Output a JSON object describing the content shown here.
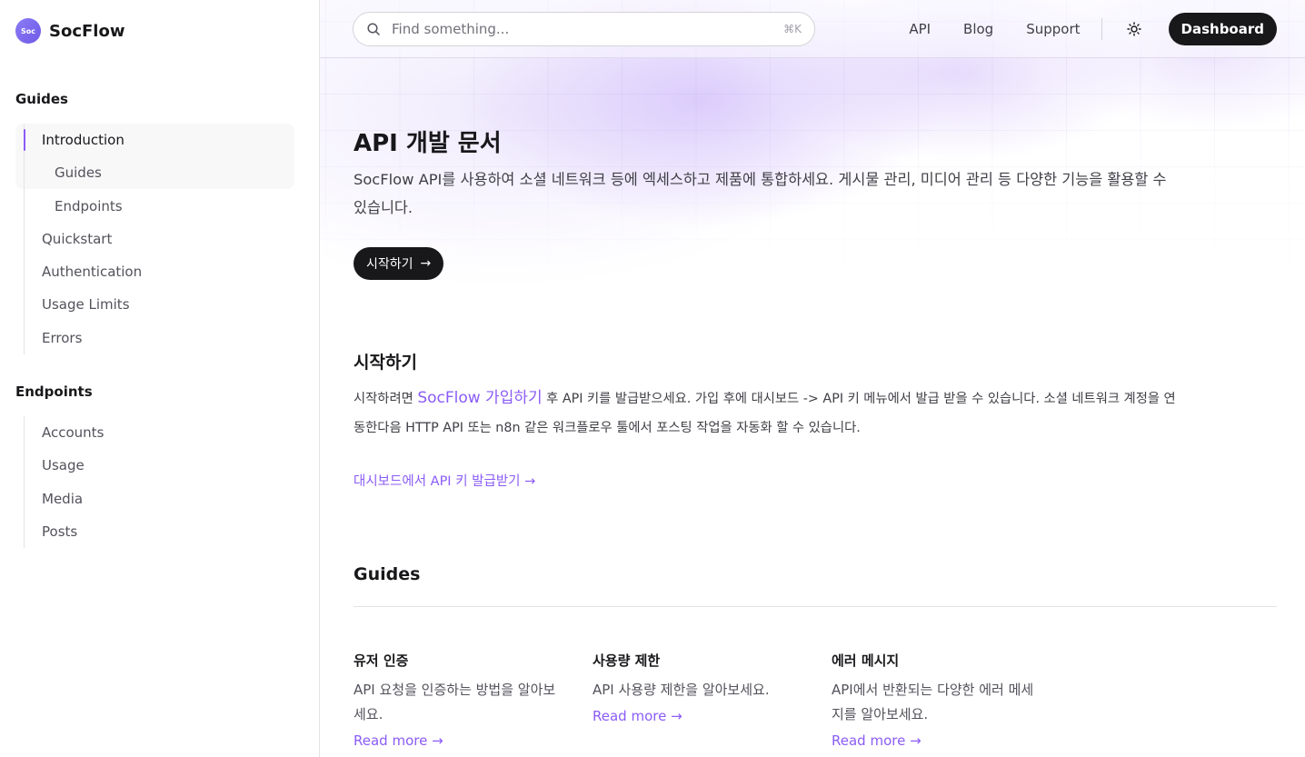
{
  "brand": {
    "logo_text": "Soc",
    "name": "SocFlow",
    "accent": "#8b5cf6"
  },
  "sidebar": {
    "sections": [
      {
        "title": "Guides",
        "items": [
          {
            "label": "Introduction",
            "active": true
          },
          {
            "label": "Guides",
            "sub": true
          },
          {
            "label": "Endpoints",
            "sub": true
          },
          {
            "label": "Quickstart"
          },
          {
            "label": "Authentication"
          },
          {
            "label": "Usage Limits"
          },
          {
            "label": "Errors"
          }
        ]
      },
      {
        "title": "Endpoints",
        "items": [
          {
            "label": "Accounts"
          },
          {
            "label": "Usage"
          },
          {
            "label": "Media"
          },
          {
            "label": "Posts"
          }
        ]
      }
    ]
  },
  "topbar": {
    "search_placeholder": "Find something...",
    "search_shortcut": "⌘K",
    "links": [
      "API",
      "Blog",
      "Support"
    ],
    "dashboard_label": "Dashboard"
  },
  "hero": {
    "title": "API 개발 문서",
    "lead": "SocFlow API를 사용하여 소셜 네트워크 등에 엑세스하고 제품에 통합하세요. 게시물 관리, 미디어 관리 등 다양한 기능을 활용할 수 있습니다.",
    "cta_label": "시작하기",
    "cta_arrow": "→"
  },
  "getting_started": {
    "title": "시작하기",
    "text_before": "시작하려면 ",
    "link": "SocFlow 가입하기",
    "text_after": " 후 API 키를 발급받으세요. 가입 후에 대시보드 -> API 키 메뉴에서 발급 받을 수 있습니다. 소셜 네트워크 계정을 연동한다음 HTTP API 또는 n8n 같은 워크플로우 툴에서 포스팅 작업을 자동화 할 수 있습니다.",
    "cta": "대시보드에서 API 키 발급받기",
    "cta_arrow": "→"
  },
  "guides": {
    "title": "Guides",
    "cards": [
      {
        "title": "유저 인증",
        "desc": "API 요청을 인증하는 방법을 알아보세요.",
        "link": "Read more →"
      },
      {
        "title": "사용량 제한",
        "desc": "API 사용량 제한을 알아보세요.",
        "link": "Read more →"
      },
      {
        "title": "에러 메시지",
        "desc": "API에서 반환되는 다양한 에러 메세지를 알아보세요.",
        "link": "Read more →"
      }
    ]
  }
}
